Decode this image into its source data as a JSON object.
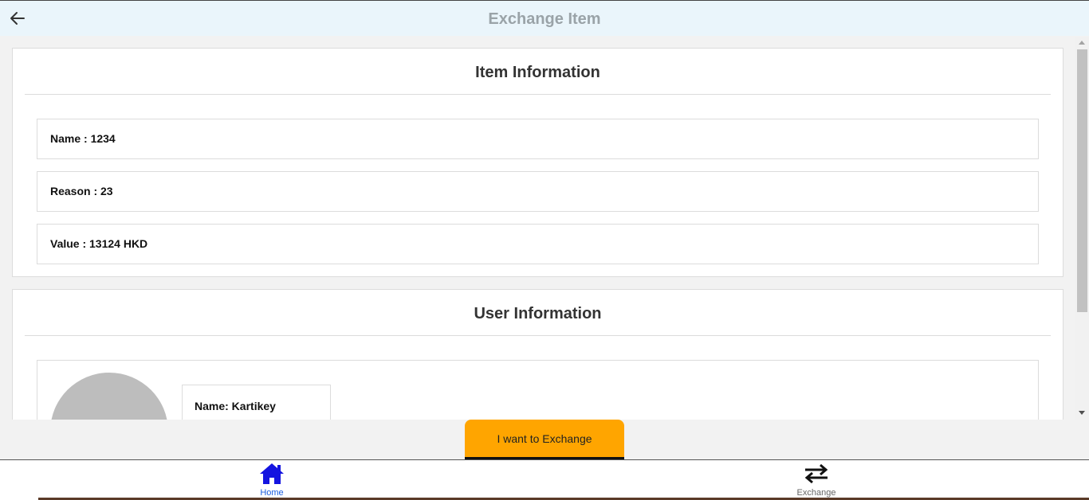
{
  "header": {
    "title": "Exchange Item",
    "back_icon": "arrow-left-icon"
  },
  "item_card": {
    "title": "Item Information",
    "rows": [
      {
        "label": "Name : 1234"
      },
      {
        "label": "Reason : 23"
      },
      {
        "label": "Value : 13124 HKD"
      }
    ]
  },
  "user_card": {
    "title": "User Information",
    "name_label": "Name: Kartikey"
  },
  "actions": {
    "exchange_button": "I want to Exchange",
    "button_color": "#ffa500"
  },
  "tabbar": {
    "tabs": [
      {
        "label": "Home",
        "icon": "home-icon",
        "active": true,
        "color": "#1a5ddf"
      },
      {
        "label": "Exchange",
        "icon": "exchange-arrows-icon",
        "active": false
      }
    ]
  }
}
